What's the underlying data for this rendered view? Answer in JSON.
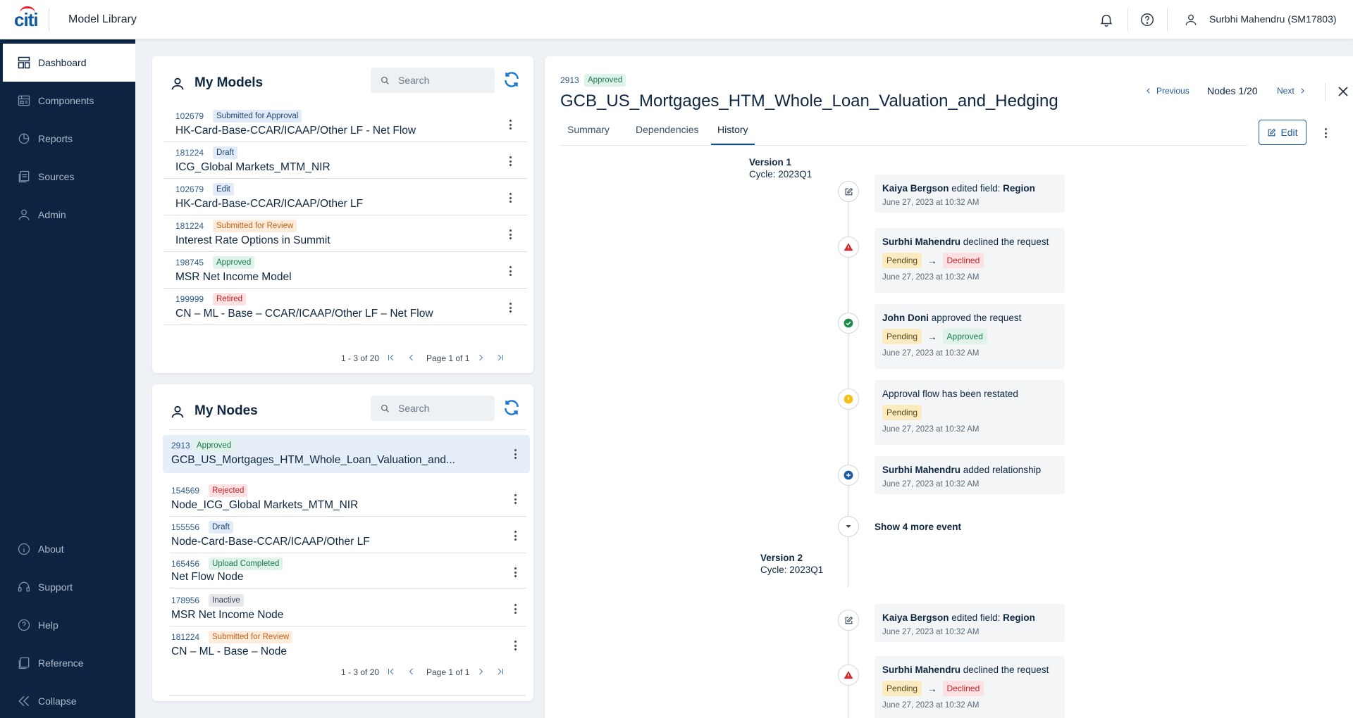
{
  "topbar": {
    "logo_text": "citi",
    "app_title": "Model Library",
    "user_name": "Surbhi Mahendru (SM17803)"
  },
  "sidebar": {
    "items": [
      {
        "label": "Dashboard",
        "icon": "dashboard-icon"
      },
      {
        "label": "Components",
        "icon": "components-icon"
      },
      {
        "label": "Reports",
        "icon": "reports-icon"
      },
      {
        "label": "Sources",
        "icon": "sources-icon"
      },
      {
        "label": "Admin",
        "icon": "admin-icon"
      }
    ],
    "bottom_items": [
      {
        "label": "About",
        "icon": "info-icon"
      },
      {
        "label": "Support",
        "icon": "headset-icon"
      },
      {
        "label": "Help",
        "icon": "question-icon"
      },
      {
        "label": "Reference",
        "icon": "reference-icon"
      },
      {
        "label": "Collapse",
        "icon": "collapse-icon"
      }
    ]
  },
  "my_models": {
    "title": "My Models",
    "search_placeholder": "Search",
    "rows": [
      {
        "id": "102679",
        "status": "Submitted for Approval",
        "name": "HK-Card-Base-CCAR/ICAAP/Other LF - Net Flow"
      },
      {
        "id": "181224",
        "status": "Draft",
        "name": "ICG_Global Markets_MTM_NIR"
      },
      {
        "id": "102679",
        "status": "Edit",
        "name": "HK-Card-Base-CCAR/ICAAP/Other LF"
      },
      {
        "id": "181224",
        "status": "Submitted for Review",
        "name": "Interest Rate Options in Summit"
      },
      {
        "id": "198745",
        "status": "Approved",
        "name": "MSR Net Income Model"
      },
      {
        "id": "199999",
        "status": "Retired",
        "name": "CN – ML - Base – CCAR/ICAAP/Other LF – Net Flow"
      }
    ],
    "pager": {
      "range": "1 - 3 of 20",
      "page": "Page 1 of 1"
    }
  },
  "my_nodes": {
    "title": "My Nodes",
    "search_placeholder": "Search",
    "rows": [
      {
        "id": "2913",
        "status": "Approved",
        "name": "GCB_US_Mortgages_HTM_Whole_Loan_Valuation_and..."
      },
      {
        "id": "154569",
        "status": "Rejected",
        "name": "Node_ICG_Global Markets_MTM_NIR"
      },
      {
        "id": "155556",
        "status": "Draft",
        "name": "Node-Card-Base-CCAR/ICAAP/Other LF"
      },
      {
        "id": "165456",
        "status": "Upload Completed",
        "name": "Net Flow Node"
      },
      {
        "id": "178956",
        "status": "Inactive",
        "name": "MSR Net Income Node"
      },
      {
        "id": "181224",
        "status": "Submitted for Review",
        "name": "CN – ML - Base – Node"
      }
    ],
    "pager": {
      "range": "1 - 3 of 20",
      "page": "Page 1 of 1"
    }
  },
  "detail": {
    "id": "2913",
    "status": "Approved",
    "title": "GCB_US_Mortgages_HTM_Whole_Loan_Valuation_and_Hedging",
    "prev_label": "Previous",
    "nodes_count": "Nodes 1/20",
    "next_label": "Next",
    "tabs": [
      "Summary",
      "Dependencies",
      "History"
    ],
    "edit_label": "Edit",
    "versions": [
      {
        "title": "Version 1",
        "cycle": "Cycle: 2023Q1"
      },
      {
        "title": "Version 2",
        "cycle": "Cycle: 2023Q1"
      }
    ],
    "events": [
      {
        "who": "Kaiya Bergson",
        "text": " edited field: ",
        "field": "Region",
        "time": "June 27, 2023 at 10:32 AM"
      },
      {
        "who": "Surbhi Mahendru",
        "text": " declined the request",
        "from": "Pending",
        "arrow": "→",
        "to": "Declined",
        "time": "June 27, 2023 at 10:32 AM"
      },
      {
        "who": "John Doni",
        "text": " approved the request",
        "from": "Pending",
        "arrow": "→",
        "to": "Approved",
        "time": "June 27, 2023 at 10:32 AM"
      },
      {
        "text": "Approval flow has been restated",
        "from": "Pending",
        "time": "June 27, 2023 at 10:32 AM"
      },
      {
        "who": "Surbhi Mahendru",
        "text": " added relationship",
        "time": "June 27, 2023 at 10:32 AM"
      },
      {
        "who": "Kaiya Bergson",
        "text": " edited field: ",
        "field": "Region",
        "time": "June 27, 2023 at 10:32 AM"
      },
      {
        "who": "Surbhi Mahendru",
        "text": " declined the request",
        "from": "Pending",
        "arrow": "→",
        "to": "Declined",
        "time": "June 27, 2023 at 10:32 AM"
      }
    ],
    "show_more": "Show 4 more event"
  },
  "colors": {
    "sidebar_bg": "#0c2441",
    "accent": "#1e5aa0",
    "refresh": "#1a7ad6",
    "success": "#1c8a4a",
    "danger": "#d42b2b",
    "warning": "#f2c018"
  }
}
